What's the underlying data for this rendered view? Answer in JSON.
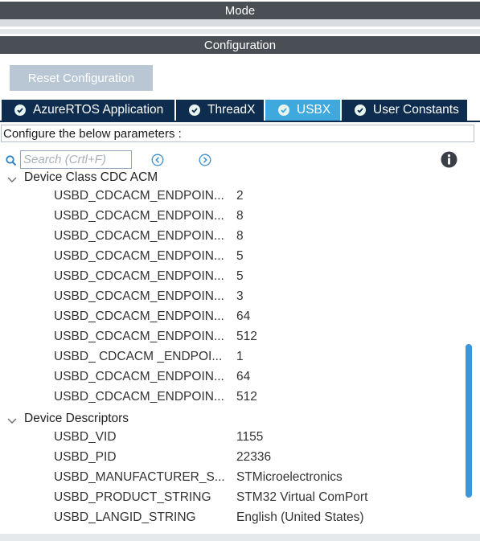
{
  "mode_header": {
    "label": "Mode"
  },
  "config_header": {
    "label": "Configuration"
  },
  "reset_button": {
    "label": "Reset Configuration"
  },
  "tabs": [
    {
      "label": "AzureRTOS Application",
      "icon": "check-circle-icon",
      "active": false
    },
    {
      "label": "ThreadX",
      "icon": "check-circle-icon",
      "active": false
    },
    {
      "label": "USBX",
      "icon": "check-circle-icon",
      "active": true
    },
    {
      "label": "User Constants",
      "icon": "check-circle-icon",
      "active": false
    }
  ],
  "configure_text": "Configure the below parameters :",
  "search": {
    "placeholder": "Search (Crtl+F)",
    "value": ""
  },
  "icons": {
    "search": "search-icon",
    "prev": "previous-arrow-icon",
    "next": "next-arrow-icon",
    "info": "info-icon",
    "chevron": "chevron-down-icon"
  },
  "tree": {
    "groups": [
      {
        "label": "Device Class CDC ACM",
        "params": [
          {
            "name": "USBD_CDCACM_ENDPOIN...",
            "value": "2"
          },
          {
            "name": "USBD_CDCACM_ENDPOIN...",
            "value": "8"
          },
          {
            "name": "USBD_CDCACM_ENDPOIN...",
            "value": "8"
          },
          {
            "name": "USBD_CDCACM_ENDPOIN...",
            "value": "5"
          },
          {
            "name": "USBD_CDCACM_ENDPOIN...",
            "value": "5"
          },
          {
            "name": "USBD_CDCACM_ENDPOIN...",
            "value": "3"
          },
          {
            "name": "USBD_CDCACM_ENDPOIN...",
            "value": "64"
          },
          {
            "name": "USBD_CDCACM_ENDPOIN...",
            "value": "512"
          },
          {
            "name": "USBD_ CDCACM _ENDPOI...",
            "value": "1"
          },
          {
            "name": "USBD_CDCACM_ENDPOIN...",
            "value": "64"
          },
          {
            "name": "USBD_CDCACM_ENDPOIN...",
            "value": "512"
          }
        ]
      },
      {
        "label": "Device Descriptors",
        "params": [
          {
            "name": "USBD_VID",
            "value": "1155"
          },
          {
            "name": "USBD_PID",
            "value": "22336"
          },
          {
            "name": "USBD_MANUFACTURER_S...",
            "value": "STMicroelectronics"
          },
          {
            "name": "USBD_PRODUCT_STRING",
            "value": "STM32 Virtual ComPort"
          },
          {
            "name": "USBD_LANGID_STRING",
            "value": "English (United States)"
          }
        ]
      }
    ]
  },
  "scrollbar": {
    "position_fraction": 0.48,
    "visible_fraction": 0.43
  },
  "colors": {
    "header_bg": "#4a4f55",
    "tab_bg": "#0d2c4e",
    "tab_active_bg": "#3fa8dd",
    "button_disabled_bg": "#b9c6d3",
    "scroll_thumb": "#3d96d8"
  }
}
